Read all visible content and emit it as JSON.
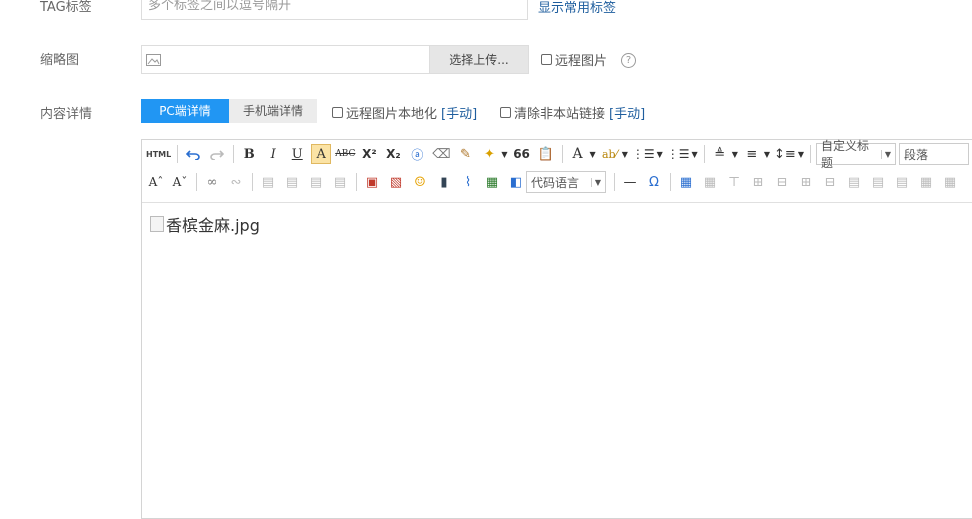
{
  "form": {
    "tag_label": "TAG标签",
    "tag_placeholder": "多个标签之间以逗号隔开",
    "tag_link": "显示常用标签",
    "thumb_label": "缩略图",
    "upload_button": "选择上传...",
    "remote_image_label": "远程图片",
    "help_glyph": "?",
    "content_label": "内容详情",
    "tabs": [
      {
        "label": "PC端详情",
        "active": true
      },
      {
        "label": "手机端详情",
        "active": false
      }
    ],
    "localize_remote_label": "远程图片本地化",
    "localize_remote_link": "[手动]",
    "clear_links_label": "清除非本站链接",
    "clear_links_link": "[手动]"
  },
  "editor": {
    "toolbar": {
      "html_label": "HTML",
      "bold": "B",
      "italic": "I",
      "underline": "U",
      "font_border": "A",
      "strike": "ABC",
      "superscript": "X²",
      "subscript": "X₂",
      "quote": "66",
      "font_color": "A",
      "custom_title": "自定义标题",
      "paragraph": "段落",
      "code_language": "代码语言",
      "omega": "Ω"
    },
    "content": {
      "image_alt": "香槟金麻.jpg"
    }
  }
}
